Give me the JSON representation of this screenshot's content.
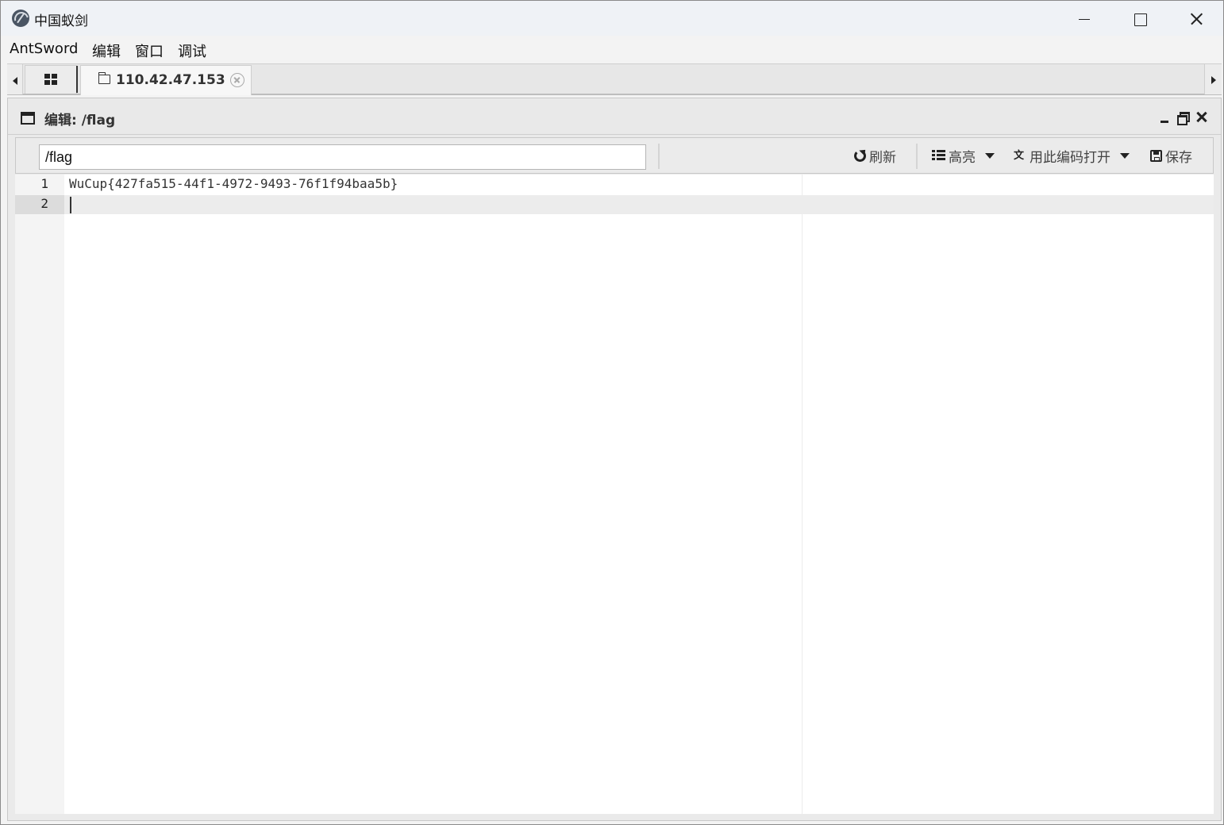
{
  "app": {
    "title": "中国蚁剑",
    "icon": "antsword-logo-icon"
  },
  "menubar": {
    "items": [
      "AntSword",
      "编辑",
      "窗口",
      "调试"
    ]
  },
  "tabs": {
    "home_icon": "grid-icon",
    "active_label": "110.42.47.153",
    "active_icon": "folder-icon"
  },
  "panel": {
    "title": "编辑: /flag"
  },
  "toolbar": {
    "path_value": "/flag",
    "refresh_label": "刷新",
    "highlight_label": "高亮",
    "encoding_label": "用此编码打开",
    "save_label": "保存"
  },
  "editor": {
    "lines": [
      {
        "num": "1",
        "text": "WuCup{427fa515-44f1-4972-9493-76f1f94baa5b}"
      },
      {
        "num": "2",
        "text": ""
      }
    ],
    "active_line": 2
  }
}
